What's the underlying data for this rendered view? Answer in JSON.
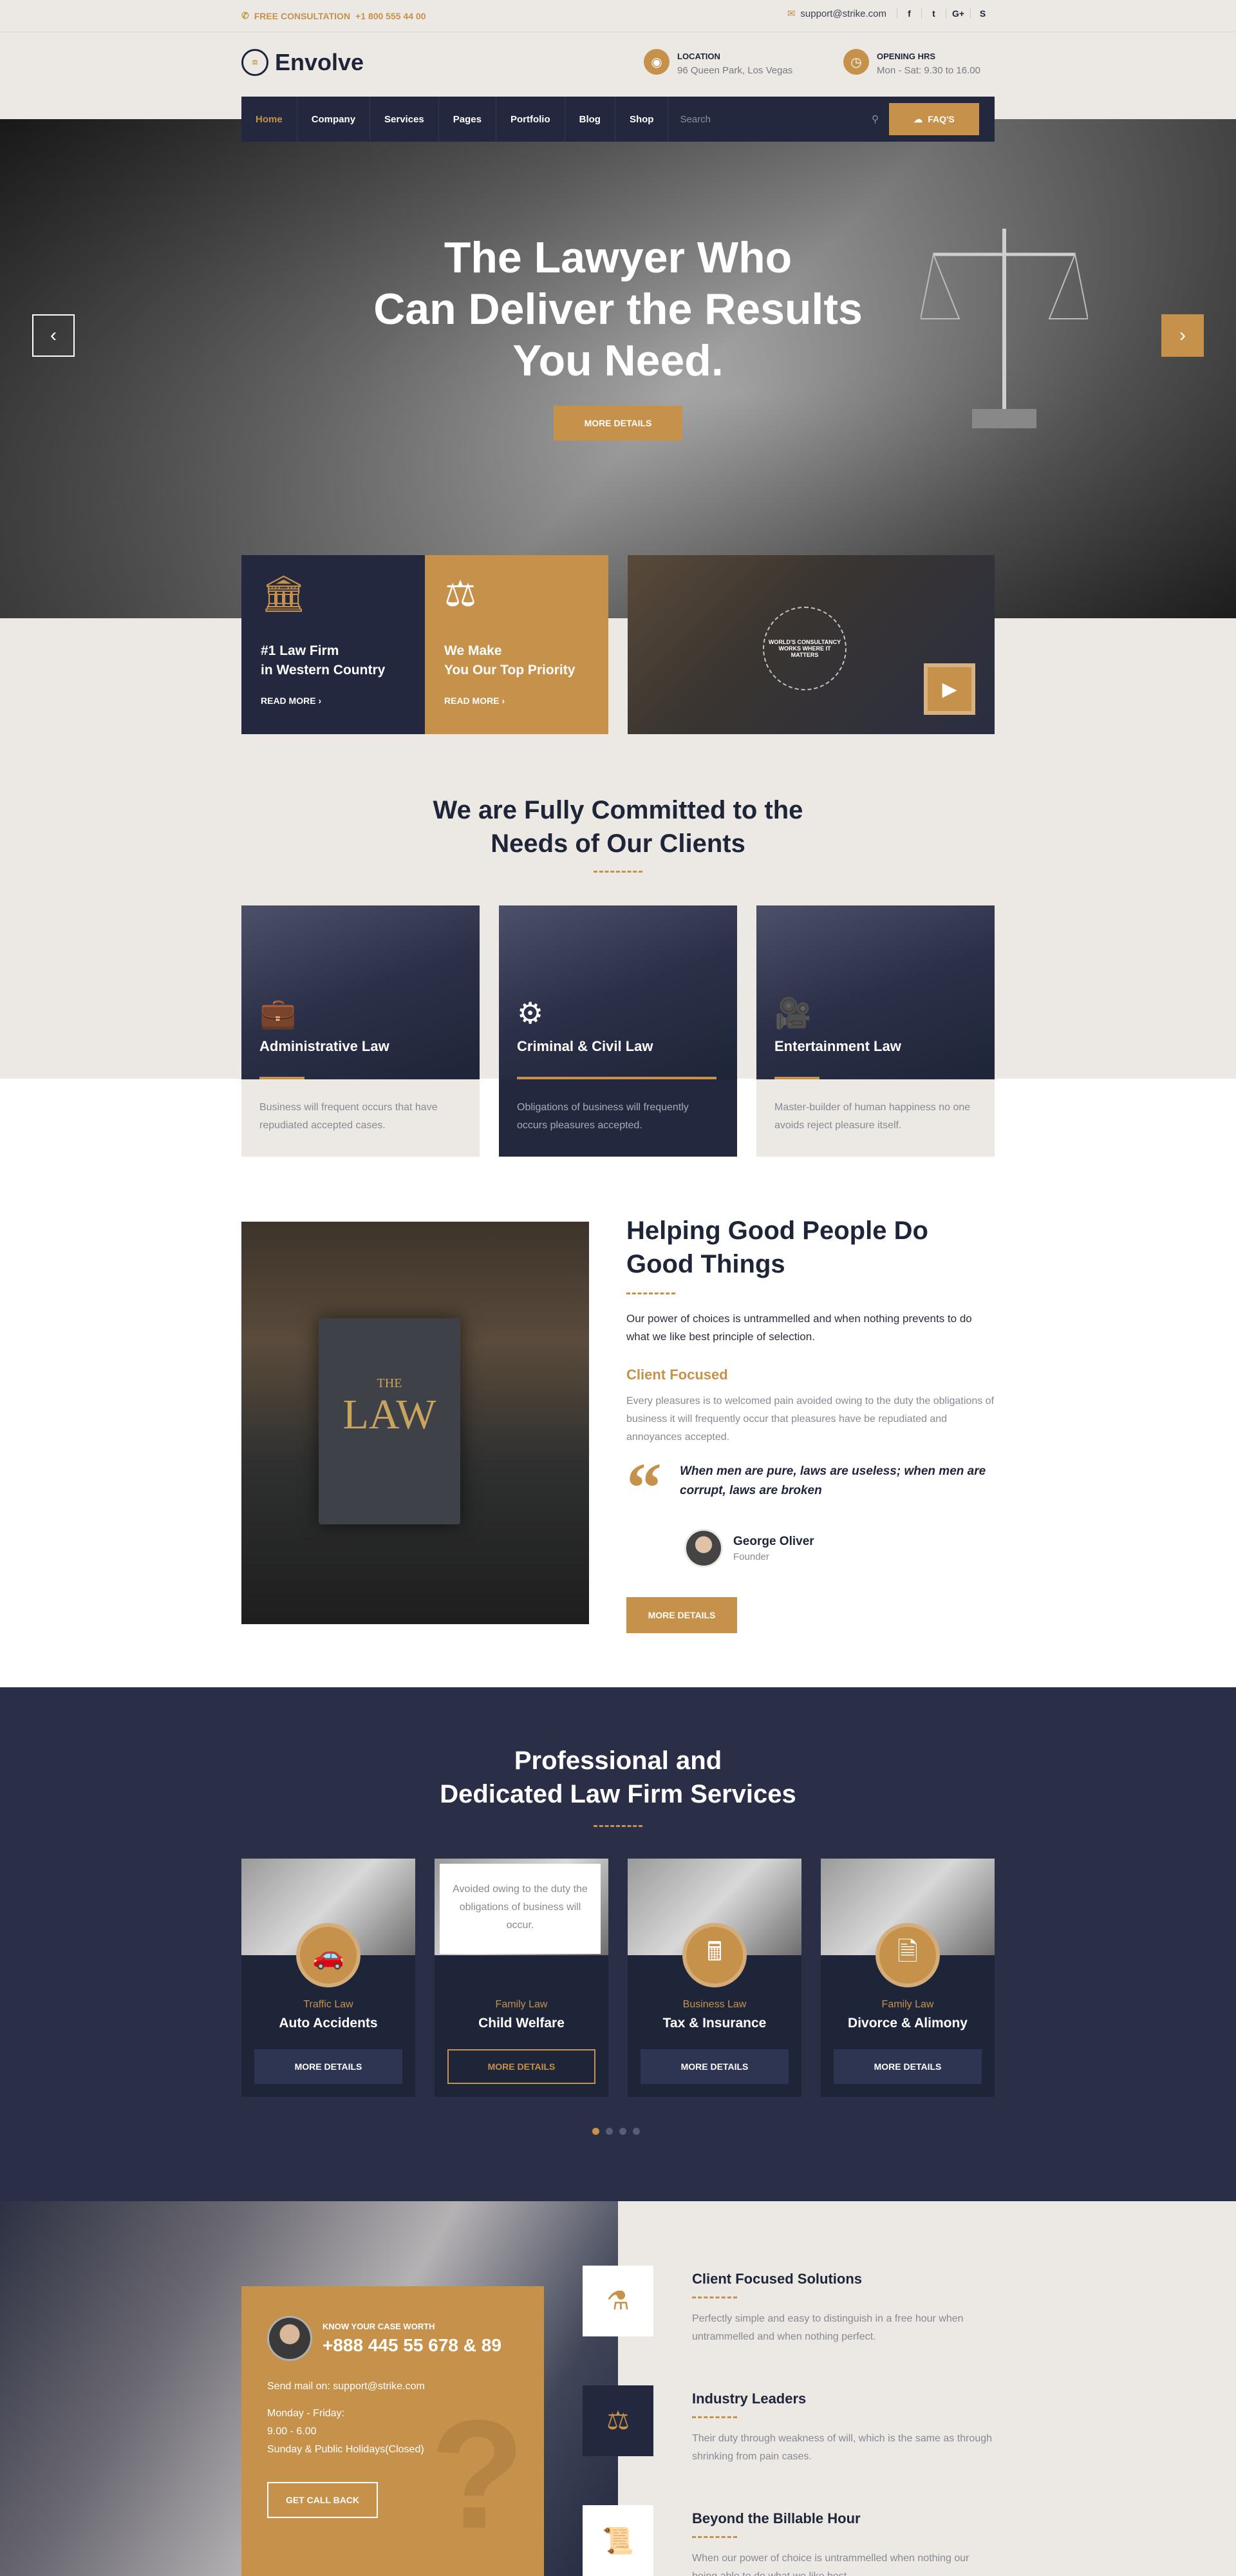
{
  "topbar": {
    "consultation": "FREE CONSULTATION",
    "phone": "+1 800 555 44 00",
    "email": "support@strike.com",
    "social": [
      {
        "icon": "facebook-icon",
        "glyph": "f"
      },
      {
        "icon": "twitter-icon",
        "glyph": "t"
      },
      {
        "icon": "google-plus-icon",
        "glyph": "G+"
      },
      {
        "icon": "skype-icon",
        "glyph": "S"
      }
    ]
  },
  "header": {
    "brand": "Envolve",
    "location_label": "LOCATION",
    "location_value": "96 Queen Park, Los Vegas",
    "hours_label": "OPENING HRS",
    "hours_value": "Mon - Sat: 9.30 to 16.00"
  },
  "nav": {
    "items": [
      "Home",
      "Company",
      "Services",
      "Pages",
      "Portfolio",
      "Blog",
      "Shop"
    ],
    "search_placeholder": "Search",
    "faq_label": "FAQ'S"
  },
  "hero": {
    "line1": "The Lawyer Who",
    "line2": "Can Deliver the Results",
    "line3": "You Need.",
    "button": "MORE DETAILS"
  },
  "features": [
    {
      "icon": "courthouse-icon",
      "line1": "#1 Law Firm",
      "line2": "in Western Country",
      "link": "READ MORE"
    },
    {
      "icon": "hand-scales-icon",
      "line1": "We Make",
      "line2": "You Our Top Priority",
      "link": "READ MORE"
    }
  ],
  "video": {
    "badge": "WORLD'S CONSULTANCY WORKS WHERE IT MATTERS"
  },
  "committed": {
    "title1": "We are Fully Committed to the",
    "title2": "Needs of Our Clients",
    "cards": [
      {
        "icon": "briefcase-icon",
        "title": "Administrative Law",
        "text": "Business will frequent occurs that have repudiated accepted cases."
      },
      {
        "icon": "handcuffs-icon",
        "title": "Criminal & Civil Law",
        "text": "Obligations of business will frequently occurs pleasures accepted."
      },
      {
        "icon": "camera-icon",
        "title": "Entertainment Law",
        "text": "Master-builder of human happiness no one avoids reject  pleasure itself."
      }
    ]
  },
  "about": {
    "image_text_the": "THE",
    "image_text_law": "LAW",
    "title1": "Helping Good People Do",
    "title2": "Good Things",
    "lead": "Our power of choices is untrammelled and when nothing prevents to do what we like best principle of selection.",
    "subhead": "Client Focused",
    "para": "Every pleasures is to welcomed pain avoided owing to the duty the obligations of business it will frequently occur that pleasures have be repudiated and annoyances accepted.",
    "quote": "When men are pure, laws are useless; when men are corrupt, laws are broken",
    "person_name": "George Oliver",
    "person_role": "Founder",
    "button": "MORE DETAILS"
  },
  "services": {
    "title1": "Professional and",
    "title2": "Dedicated Law Firm Services",
    "popup_text": "Avoided owing to the duty the obligations of business will occur.",
    "items": [
      {
        "icon": "car-crash-icon",
        "category": "Traffic Law",
        "name": "Auto Accidents",
        "button": "MORE DETAILS"
      },
      {
        "icon": "family-icon",
        "category": "Family Law",
        "name": "Child Welfare",
        "button": "MORE DETAILS"
      },
      {
        "icon": "calculator-icon",
        "category": "Business Law",
        "name": "Tax & Insurance",
        "button": "MORE DETAILS"
      },
      {
        "icon": "document-icon",
        "category": "Family Law",
        "name": "Divorce & Alimony",
        "button": "MORE DETAILS"
      }
    ]
  },
  "case": {
    "label": "KNOW YOUR CASE WORTH",
    "phone": "+888 445 55 678 & 89",
    "mail": "Send mail on: support@strike.com",
    "hours1": "Monday - Friday:",
    "hours2": "9.00 - 6.00",
    "hours3": "Sunday & Public Holidays(Closed)",
    "button": "GET CALL BACK"
  },
  "benefits": [
    {
      "icon": "lawyer-icon",
      "title": "Client Focused Solutions",
      "text": "Perfectly simple and easy to distinguish in a free hour when untrammelled and when nothing perfect."
    },
    {
      "icon": "scales-icon",
      "title": "Industry Leaders",
      "text": "Their duty through weakness of will, which is the same as through shrinking from pain cases."
    },
    {
      "icon": "certificate-icon",
      "title": "Beyond the Billable Hour",
      "text": "When our power of choice is untrammelled when nothing our being able to do what we like best."
    }
  ]
}
